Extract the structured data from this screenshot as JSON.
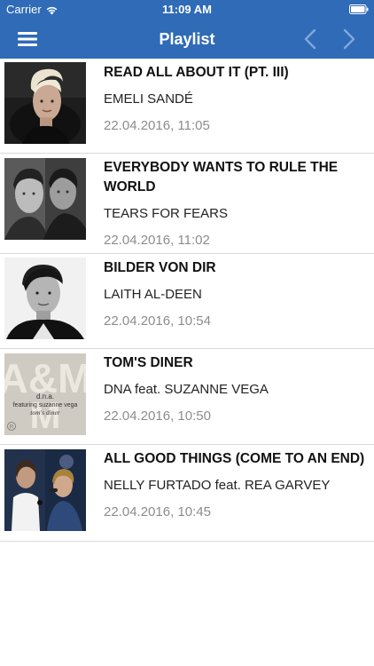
{
  "status_bar": {
    "carrier": "Carrier",
    "time": "11:09 AM",
    "wifi_icon": "wifi-icon",
    "battery_icon": "battery-icon"
  },
  "nav": {
    "title": "Playlist",
    "menu_icon": "hamburger-menu-icon",
    "prev_icon": "chevron-left-icon",
    "next_icon": "chevron-right-icon",
    "bar_color": "#2f6bb7"
  },
  "playlist": [
    {
      "title": "READ ALL ABOUT IT (PT. III)",
      "artist": "EMELI SANDÉ",
      "played_at": "22.04.2016, 11:05"
    },
    {
      "title": "EVERYBODY WANTS TO RULE THE WORLD",
      "artist": "TEARS FOR FEARS",
      "played_at": "22.04.2016, 11:02"
    },
    {
      "title": "BILDER VON DIR",
      "artist": "LAITH AL-DEEN",
      "played_at": "22.04.2016, 10:54"
    },
    {
      "title": "TOM'S DINER",
      "artist": "DNA feat. SUZANNE VEGA",
      "played_at": "22.04.2016, 10:50"
    },
    {
      "title": "ALL GOOD THINGS (COME TO AN END)",
      "artist": "NELLY FURTADO feat. REA GARVEY",
      "played_at": "22.04.2016, 10:45"
    }
  ],
  "covers": {
    "toms_diner": {
      "big_text": "A&M",
      "line1": "d.n.a.",
      "line2": "featuring suzanne vega",
      "line3": "tom's diner",
      "mark": "R"
    }
  }
}
